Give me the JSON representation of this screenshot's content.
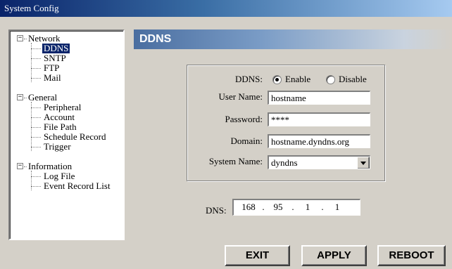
{
  "window": {
    "title": "System Config"
  },
  "tree": {
    "network": {
      "label": "Network",
      "expander": "−",
      "children": [
        "DDNS",
        "SNTP",
        "FTP",
        "Mail"
      ]
    },
    "general": {
      "label": "General",
      "expander": "−",
      "children": [
        "Peripheral",
        "Account",
        "File Path",
        "Schedule Record",
        "Trigger"
      ]
    },
    "information": {
      "label": "Information",
      "expander": "−",
      "children": [
        "Log File",
        "Event Record List"
      ]
    },
    "selected": "DDNS"
  },
  "content": {
    "title": "DDNS",
    "ddns": {
      "label": "DDNS:",
      "options": [
        "Enable",
        "Disable"
      ],
      "selected": "Enable"
    },
    "username": {
      "label": "User Name:",
      "value": "hostname"
    },
    "password": {
      "label": "Password:",
      "value": "****"
    },
    "domain": {
      "label": "Domain:",
      "value": "hostname.dyndns.org"
    },
    "system_name": {
      "label": "System Name:",
      "value": "dyndns"
    },
    "dns": {
      "label": "DNS:",
      "octets": [
        "168",
        "95",
        "1",
        "1"
      ],
      "separator": "."
    }
  },
  "buttons": {
    "exit": "EXIT",
    "apply": "APPLY",
    "reboot": "REBOOT"
  }
}
